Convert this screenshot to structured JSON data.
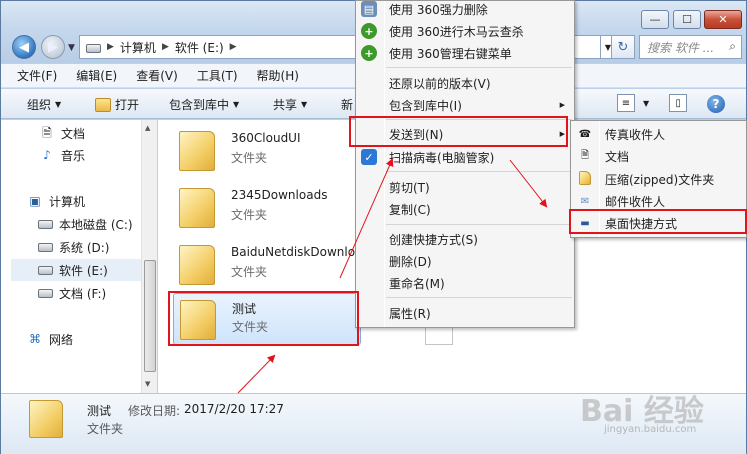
{
  "address": {
    "segments": [
      "计算机",
      "软件 (E:)"
    ]
  },
  "search": {
    "placeholder": "搜索 软件 ..."
  },
  "menubar": [
    "文件(F)",
    "编辑(E)",
    "查看(V)",
    "工具(T)",
    "帮助(H)"
  ],
  "toolbar": {
    "organize": "组织",
    "open": "打开",
    "include": "包含到库中",
    "share": "共享",
    "new": "新"
  },
  "nav": {
    "items": [
      {
        "label": "文档",
        "icon": "document-icon"
      },
      {
        "label": "音乐",
        "icon": "music-icon"
      },
      {
        "label": "计算机",
        "icon": "computer-icon"
      },
      {
        "label": "本地磁盘 (C:)",
        "icon": "drive-icon"
      },
      {
        "label": "系统 (D:)",
        "icon": "drive-icon"
      },
      {
        "label": "软件 (E:)",
        "icon": "drive-icon"
      },
      {
        "label": "文档 (F:)",
        "icon": "drive-icon"
      },
      {
        "label": "网络",
        "icon": "network-icon"
      }
    ]
  },
  "files": [
    {
      "name": "360CloudUI",
      "type": "文件夹"
    },
    {
      "name": "2345Downloads",
      "type": "文件夹"
    },
    {
      "name": "BaiduNetdiskDownlo",
      "type": "文件夹"
    },
    {
      "name": "测试",
      "type": "文件夹"
    }
  ],
  "context_menu": {
    "items": [
      "使用 360强力删除",
      "使用 360进行木马云查杀",
      "使用 360管理右键菜单",
      "还原以前的版本(V)",
      "包含到库中(I)",
      "发送到(N)",
      "扫描病毒(电脑管家)",
      "剪切(T)",
      "复制(C)",
      "创建快捷方式(S)",
      "删除(D)",
      "重命名(M)",
      "属性(R)"
    ]
  },
  "sendto_menu": {
    "items": [
      "传真收件人",
      "文档",
      "压缩(zipped)文件夹",
      "邮件收件人",
      "桌面快捷方式"
    ]
  },
  "details": {
    "name": "测试",
    "modified_label": "修改日期:",
    "modified": "2017/2/20 17:27",
    "type": "文件夹"
  },
  "watermark": {
    "text": "Bai 经验",
    "url": "jingyan.baidu.com"
  },
  "colors": {
    "highlight_box": "#e0141a",
    "selection": "#cfe4fb"
  }
}
